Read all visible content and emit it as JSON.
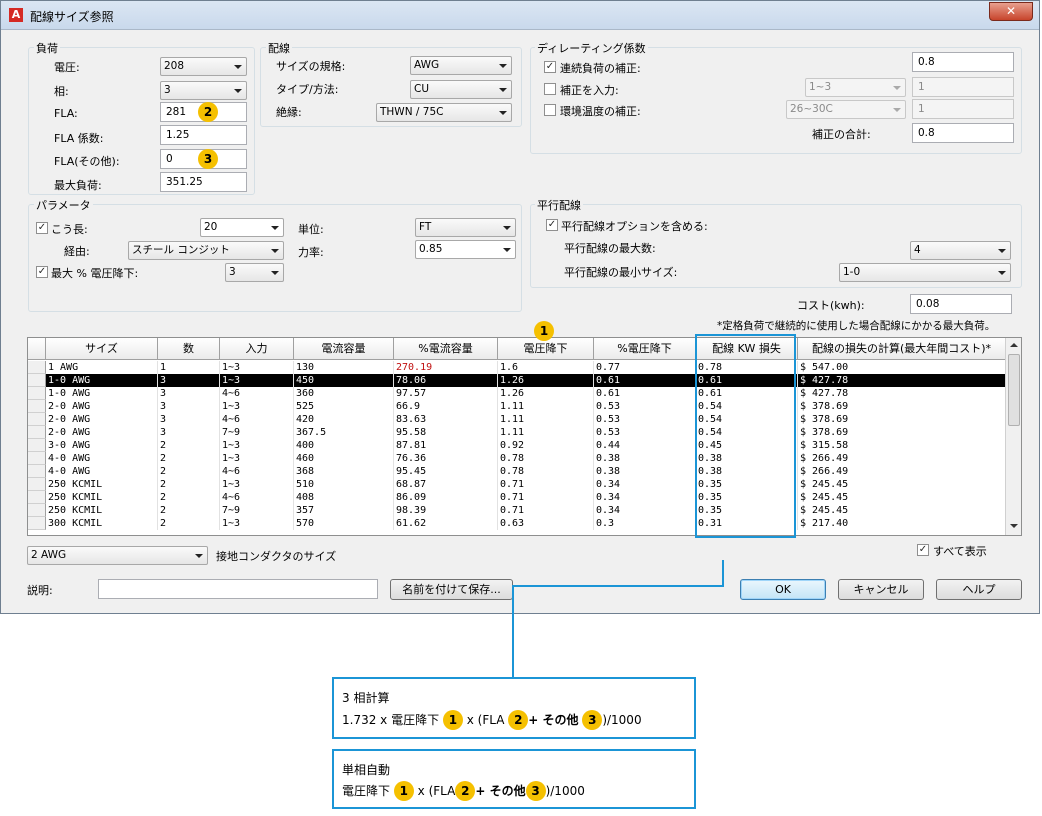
{
  "window": {
    "title": "配線サイズ参照",
    "app_icon": "A",
    "close_label": "✕"
  },
  "load": {
    "title": "負荷",
    "voltage_label": "電圧:",
    "voltage": "208",
    "phase_label": "相:",
    "phase": "3",
    "fla_label": "FLA:",
    "fla": "281",
    "fla_factor_label": "FLA 係数:",
    "fla_factor": "1.25",
    "fla_other_label": "FLA(その他):",
    "fla_other": "0",
    "max_load_label": "最大負荷:",
    "max_load": "351.25"
  },
  "wire": {
    "title": "配線",
    "standard_label": "サイズの規格:",
    "standard": "AWG",
    "type_label": "タイプ/方法:",
    "type": "CU",
    "insulation_label": "絶縁:",
    "insulation": "THWN / 75C"
  },
  "derating": {
    "title": "ディレーティング係数",
    "continuous_label": "連続負荷の補正:",
    "continuous_checked": true,
    "continuous_value": "0.8",
    "input_label": "補正を入力:",
    "input_checked": false,
    "input_combo": "1~3",
    "input_value": "1",
    "ambient_label": "環境温度の補正:",
    "ambient_checked": false,
    "ambient_combo": "26~30C",
    "ambient_value": "1",
    "total_label": "補正の合計:",
    "total_value": "0.8"
  },
  "parameters": {
    "title": "パラメータ",
    "length_label": "こう長:",
    "length_checked": true,
    "length": "20",
    "unit_label": "単位:",
    "unit": "FT",
    "route_label": "経由:",
    "route": "スチール コンジット",
    "power_factor_label": "力率:",
    "power_factor": "0.85",
    "max_drop_label": "最大 % 電圧降下:",
    "max_drop_checked": true,
    "max_drop": "3"
  },
  "parallel": {
    "title": "平行配線",
    "include_label": "平行配線オプションを含める:",
    "include_checked": true,
    "max_count_label": "平行配線の最大数:",
    "max_count": "4",
    "min_size_label": "平行配線の最小サイズ:",
    "min_size": "1-0"
  },
  "cost": {
    "label": "コスト(kwh):",
    "value": "0.08"
  },
  "note": "*定格負荷で継続的に使用した場合配線にかかる最大負荷。",
  "table": {
    "headers": [
      "サイズ",
      "数",
      "入力",
      "電流容量",
      "%電流容量",
      "電圧降下",
      "%電圧降下",
      "配線 KW 損失",
      "配線の損失の計算(最大年間コスト)*"
    ],
    "rows": [
      [
        "1 AWG",
        "1",
        "1~3",
        "130",
        "270.19",
        "1.6",
        "0.77",
        "0.78",
        "$ 547.00"
      ],
      [
        "1-0 AWG",
        "3",
        "1~3",
        "450",
        "78.06",
        "1.26",
        "0.61",
        "0.61",
        "$ 427.78"
      ],
      [
        "1-0 AWG",
        "3",
        "4~6",
        "360",
        "97.57",
        "1.26",
        "0.61",
        "0.61",
        "$ 427.78"
      ],
      [
        "2-0 AWG",
        "3",
        "1~3",
        "525",
        "66.9",
        "1.11",
        "0.53",
        "0.54",
        "$ 378.69"
      ],
      [
        "2-0 AWG",
        "3",
        "4~6",
        "420",
        "83.63",
        "1.11",
        "0.53",
        "0.54",
        "$ 378.69"
      ],
      [
        "2-0 AWG",
        "3",
        "7~9",
        "367.5",
        "95.58",
        "1.11",
        "0.53",
        "0.54",
        "$ 378.69"
      ],
      [
        "3-0 AWG",
        "2",
        "1~3",
        "400",
        "87.81",
        "0.92",
        "0.44",
        "0.45",
        "$ 315.58"
      ],
      [
        "4-0 AWG",
        "2",
        "1~3",
        "460",
        "76.36",
        "0.78",
        "0.38",
        "0.38",
        "$ 266.49"
      ],
      [
        "4-0 AWG",
        "2",
        "4~6",
        "368",
        "95.45",
        "0.78",
        "0.38",
        "0.38",
        "$ 266.49"
      ],
      [
        "250 KCMIL",
        "2",
        "1~3",
        "510",
        "68.87",
        "0.71",
        "0.34",
        "0.35",
        "$ 245.45"
      ],
      [
        "250 KCMIL",
        "2",
        "4~6",
        "408",
        "86.09",
        "0.71",
        "0.34",
        "0.35",
        "$ 245.45"
      ],
      [
        "250 KCMIL",
        "2",
        "7~9",
        "357",
        "98.39",
        "0.71",
        "0.34",
        "0.35",
        "$ 245.45"
      ],
      [
        "300 KCMIL",
        "2",
        "1~3",
        "570",
        "61.62",
        "0.63",
        "0.3",
        "0.31",
        "$ 217.40"
      ]
    ],
    "selected_row": 1,
    "highlight_color": "#c01010"
  },
  "footer": {
    "ground_size": "2 AWG",
    "ground_label": "接地コンダクタのサイズ",
    "show_all_label": "すべて表示",
    "show_all_checked": true,
    "description_label": "説明:",
    "description_value": "",
    "save_as_label": "名前を付けて保存...",
    "ok_label": "OK",
    "cancel_label": "キャンセル",
    "help_label": "ヘルプ"
  },
  "callouts": {
    "badge1": "1",
    "badge2": "2",
    "badge3": "3",
    "accent_color": "#1b95d6",
    "badge_color": "#f5c000"
  },
  "formulas": {
    "three_phase": {
      "title": "3 相計算",
      "p1": "1.732 x 電圧降下",
      "p2": "x (FLA",
      "p3": "+ その他",
      "p4": ")/1000"
    },
    "single_phase": {
      "title": "単相自動",
      "p1": "電圧降下",
      "p2": "x (FLA",
      "p3": "+ その他",
      "p4": ")/1000"
    }
  }
}
